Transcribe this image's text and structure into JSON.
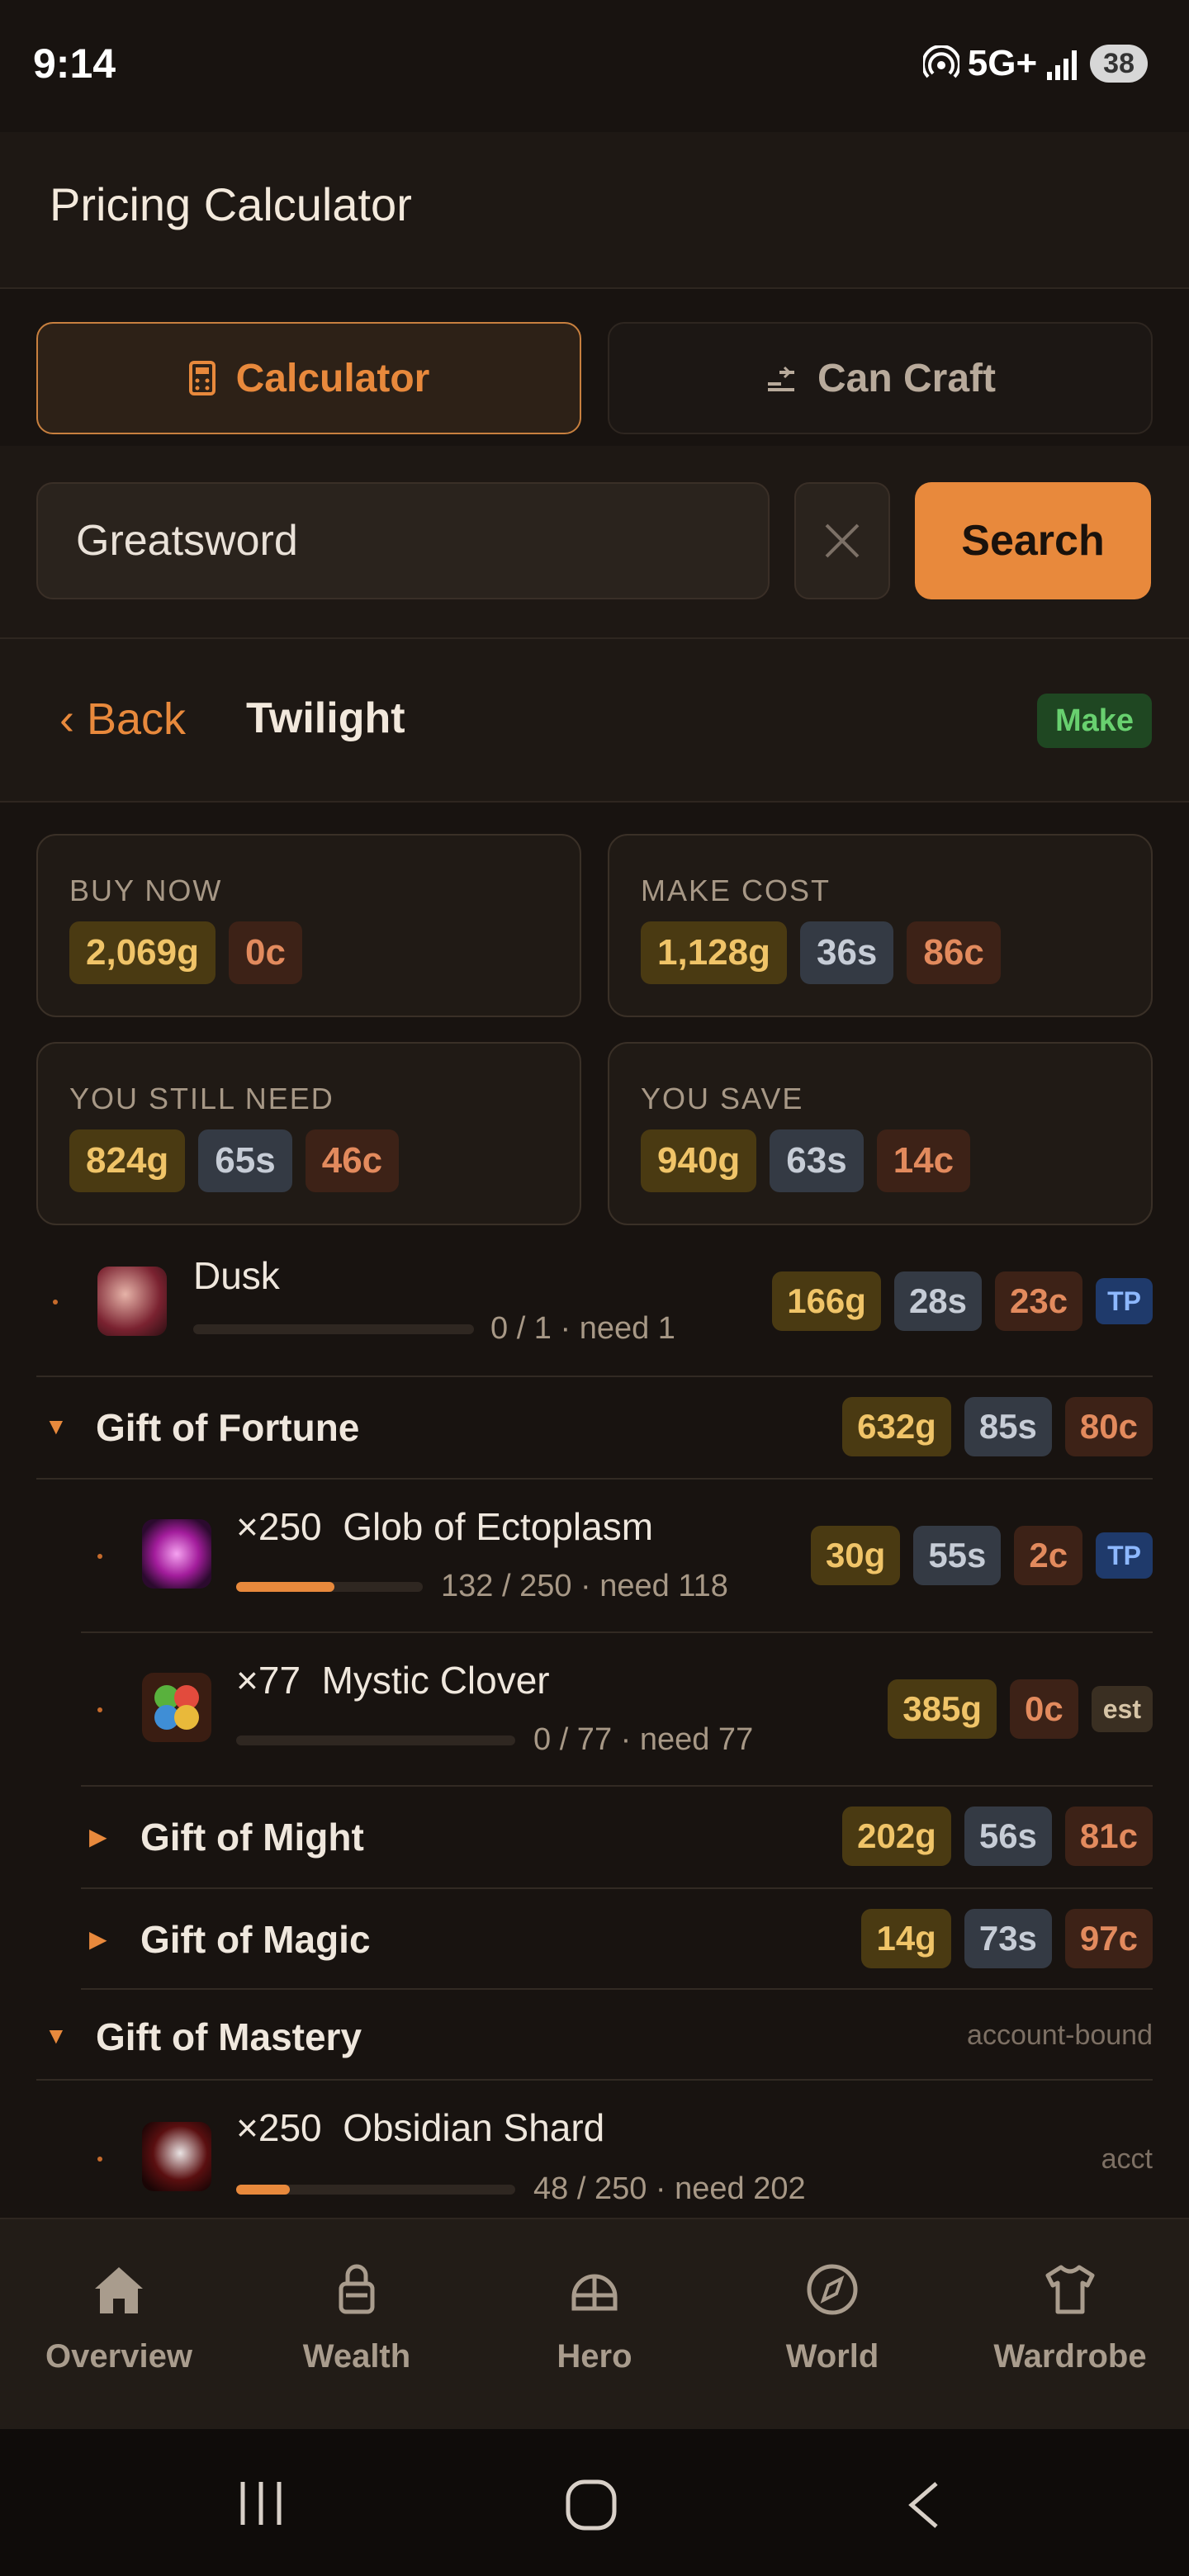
{
  "status": {
    "time": "9:14",
    "network": "5G+",
    "battery": "38"
  },
  "header": {
    "title": "Pricing Calculator"
  },
  "tabs": [
    {
      "label": "Calculator",
      "icon": "calculator-icon",
      "active": true
    },
    {
      "label": "Can Craft",
      "icon": "list-filter-icon",
      "active": false
    }
  ],
  "search": {
    "value": "Greatsword",
    "button_label": "Search"
  },
  "breadcrumb": {
    "back_label": "‹ Back",
    "item_name": "Twilight",
    "badge": "Make"
  },
  "summary": {
    "buy_now": {
      "label": "BUY NOW",
      "gold": "2,069g",
      "copper": "0c"
    },
    "make_cost": {
      "label": "MAKE COST",
      "gold": "1,128g",
      "silver": "36s",
      "copper": "86c"
    },
    "still_need": {
      "label": "YOU STILL NEED",
      "gold": "824g",
      "silver": "65s",
      "copper": "46c"
    },
    "you_save": {
      "label": "YOU SAVE",
      "gold": "940g",
      "silver": "63s",
      "copper": "14c"
    }
  },
  "components": [
    {
      "name": "Dusk",
      "progress_text": "0 / 1 · need 1",
      "progress": 0,
      "gold": "166g",
      "silver": "28s",
      "copper": "23c",
      "tag": "TP"
    },
    {
      "name": "Gift of Fortune",
      "gold": "632g",
      "silver": "85s",
      "copper": "80c"
    },
    {
      "qty": "×250",
      "name": "Glob of Ectoplasm",
      "progress_text": "132 / 250 · need 118",
      "progress": 0.528,
      "gold": "30g",
      "silver": "55s",
      "copper": "2c",
      "tag": "TP"
    },
    {
      "qty": "×77",
      "name": "Mystic Clover",
      "progress_text": "0 / 77 · need 77",
      "progress": 0,
      "gold": "385g",
      "copper": "0c",
      "tag": "est"
    },
    {
      "name": "Gift of Might",
      "gold": "202g",
      "silver": "56s",
      "copper": "81c"
    },
    {
      "name": "Gift of Magic",
      "gold": "14g",
      "silver": "73s",
      "copper": "97c"
    },
    {
      "name": "Gift of Mastery",
      "note": "account-bound"
    },
    {
      "qty": "×250",
      "name": "Obsidian Shard",
      "progress_text": "48 / 250 · need 202",
      "progress": 0.192,
      "note": "acct"
    }
  ],
  "nav": [
    {
      "label": "Overview",
      "icon": "home-icon"
    },
    {
      "label": "Wealth",
      "icon": "lock-icon"
    },
    {
      "label": "Hero",
      "icon": "helmet-icon"
    },
    {
      "label": "World",
      "icon": "compass-icon"
    },
    {
      "label": "Wardrobe",
      "icon": "shirt-icon"
    }
  ]
}
